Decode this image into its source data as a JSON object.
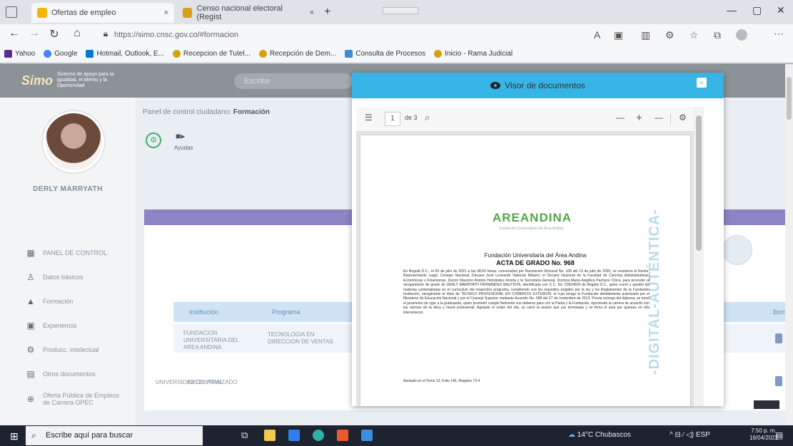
{
  "browser": {
    "tabs": [
      {
        "label": "Ofertas de empleo",
        "close": "×"
      },
      {
        "label": "Censo nacional electoral (Regist",
        "close": "×"
      }
    ],
    "new_tab": "+",
    "url": "https://simo.cnsc.gov.co/#formacion",
    "window_controls": {
      "minimize": "—",
      "maximize": "▢",
      "close": "✕"
    },
    "favorites": [
      {
        "label": "Yahoo",
        "color": "#5c2d91"
      },
      {
        "label": "Google",
        "color": "#4285f4"
      },
      {
        "label": "Hotmail, Outlook, E...",
        "color": "#0078d4"
      },
      {
        "label": "Recepcion de Tutel...",
        "color": "#d4a017"
      },
      {
        "label": "Recepción de Dem...",
        "color": "#d4a017"
      },
      {
        "label": "Consulta de Procesos",
        "color": "#3b8ed0"
      },
      {
        "label": "Inicio - Rama Judicial",
        "color": "#d4a017"
      }
    ]
  },
  "site": {
    "logo_mark": "Simo",
    "logo_text": "Sistema de apoyo para la igualdad, el Mérito y la Oportunidad",
    "search_placeholder": "Escribe",
    "user_name": "DERLY MARRYATH",
    "breadcrumb_prefix": "Panel de control ciudadano:",
    "breadcrumb_current": "Formación",
    "ayudas_label": "Ayudas",
    "sidebar": [
      {
        "icon": "dashboard-icon",
        "glyph": "▦",
        "label": "PANEL DE CONTROL"
      },
      {
        "icon": "user-icon",
        "glyph": "♙",
        "label": "Datos básicos"
      },
      {
        "icon": "education-icon",
        "glyph": "🎓",
        "label": "Formación"
      },
      {
        "icon": "briefcase-icon",
        "glyph": "▣",
        "label": "Experiencia"
      },
      {
        "icon": "production-icon",
        "glyph": "⚙",
        "label": "Producc. intelectual"
      },
      {
        "icon": "documents-icon",
        "glyph": "▤",
        "label": "Otros documentos"
      },
      {
        "icon": "globe-icon",
        "glyph": "⊕",
        "label": "Oferta Pública de Empleos de Carrera OPEC"
      }
    ],
    "table": {
      "headers": [
        "Institución",
        "Programa",
        "Borrar"
      ],
      "rows": [
        {
          "institution": "FUNDACION UNIVERSITARIA DEL AREA ANDINA",
          "program": "TECNOLOGIA EN DIRECCION DE VENTAS"
        },
        {
          "institution": "UNIVERSIDAD CENTRAL",
          "program": "EXCEL AVANZADO"
        }
      ]
    }
  },
  "viewer": {
    "title": "Visor de documentos",
    "close": "×",
    "page_current": "1",
    "page_total": "de 3",
    "zoom_out": "—",
    "zoom_in": "+",
    "doc": {
      "logo": "AREANDINA",
      "logo_sub": "Fundación Universitaria del Área Andina",
      "stamp": "-DIGITAL-AUTÉNTICA-",
      "institution": "Fundación Universitaria del Área Andina",
      "title": "ACTA DE GRADO No. 968",
      "body": "En Bogotá D.C., el 06 de julio de 2021 a las 08:00 horas, convocados por Resolución Rectoral No. 109 del 13 de julio de 2020, se reunieron el Rector, Representante Legal, Consejo Nacional, Decano José Leonardo Valencia Molano; el Decano Nacional de la Facultad de Ciencias Administrativas, Económicas y Financieras, Doctor Mauricio Andrés Hernández Arrieta y la Secretaria General, Doctora María Angélica Pacheco Chica, para proceder al otorgamiento de grado de DERLY MARRYATH FERNANDEZ BAUTISTA, identificada con C.C. No. 53024624 de Bogotá D.C., quien cursó y aprobó las materias contempladas en el currículum del respectivo programa, cumpliendo con los requisitos exigidos por la ley y los Reglamentos de la Fundación Institución, otorgándole el título de TÉCNICO PROFESIONAL EN COMERCIO EXTERIOR, el cual otorga la Fundación debidamente autorizada por el Ministerio de Educación Nacional y por el Consejo Superior mediante Acuerdo No. 068 del 27 de noviembre de 2013. Previa entrega del diploma, se tomó el juramento de rigor a la graduanda, quien prometió cumplir fielmente sus deberes para con la Patria y la Fundación, ejerciendo la carrera de acuerdo con las normas de la ética y moral profesional. Agotado el orden del día, se cerró la sesión que por terminada y se firma el acta por quienes en ella intervinieron.",
      "footer": "Anotado en el Tomo 13, Folio 146, Registro 73-4"
    }
  },
  "taskbar": {
    "search_placeholder": "Escribe aquí para buscar",
    "weather": "14°C  Chubascos",
    "tray": "^  ⊟  ⁄  ◁)  ESP",
    "time": "7:50 p. m.",
    "date": "16/04/2022"
  }
}
